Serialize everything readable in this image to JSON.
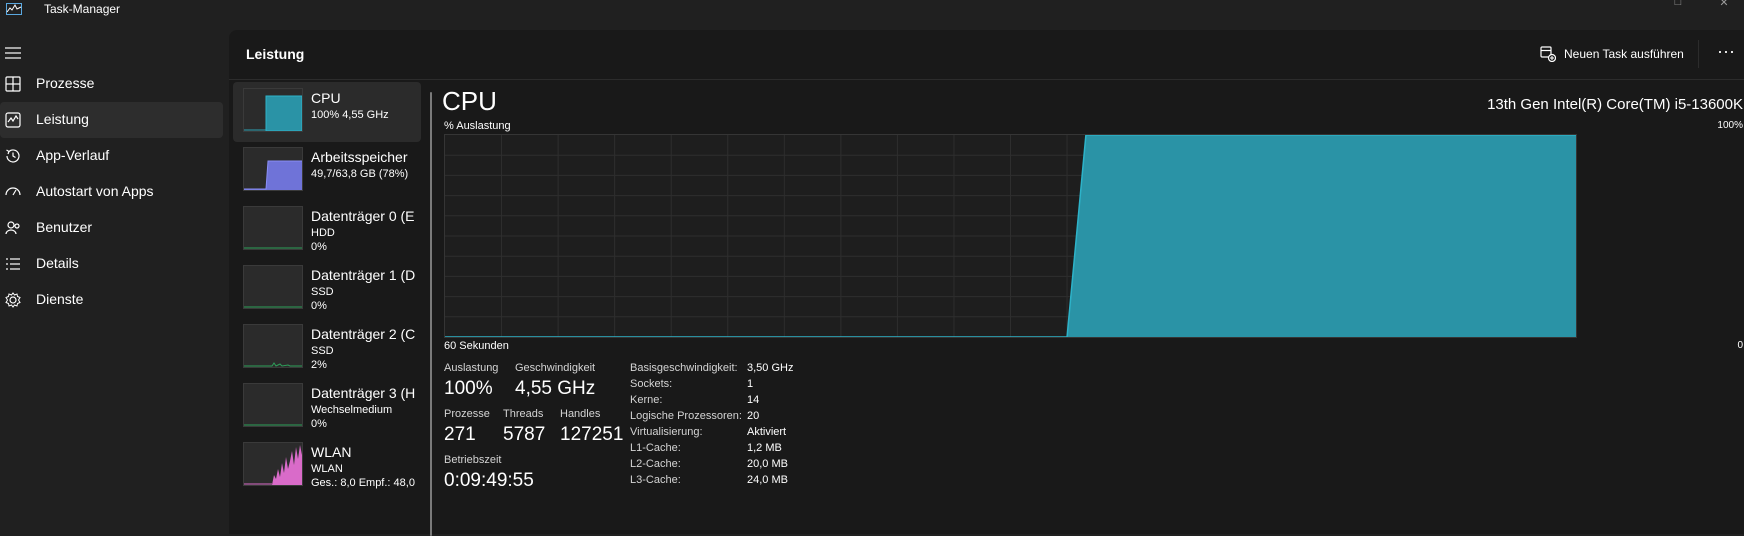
{
  "window": {
    "title": "Task-Manager"
  },
  "nav": {
    "items": [
      {
        "label": "Prozesse",
        "icon": "processes-icon"
      },
      {
        "label": "Leistung",
        "icon": "performance-icon",
        "selected": true
      },
      {
        "label": "App-Verlauf",
        "icon": "history-icon"
      },
      {
        "label": "Autostart von Apps",
        "icon": "startup-icon"
      },
      {
        "label": "Benutzer",
        "icon": "users-icon"
      },
      {
        "label": "Details",
        "icon": "details-icon"
      },
      {
        "label": "Dienste",
        "icon": "services-icon"
      }
    ]
  },
  "header": {
    "title": "Leistung",
    "new_task_label": "Neuen Task ausführen",
    "more_label": "···"
  },
  "resources": [
    {
      "name": "CPU",
      "line1": "100%  4,55 GHz",
      "line2": "",
      "color": "#2da0b3",
      "usage": 1.0
    },
    {
      "name": "Arbeitsspeicher",
      "line1": "49,7/63,8 GB (78%)",
      "line2": "",
      "color": "#7b7ff0",
      "usage": 0.78
    },
    {
      "name": "Datenträger 0 (E",
      "line1": "HDD",
      "line2": "0%",
      "color": "#2da05a",
      "usage": 0
    },
    {
      "name": "Datenträger 1 (D",
      "line1": "SSD",
      "line2": "0%",
      "color": "#2da05a",
      "usage": 0
    },
    {
      "name": "Datenträger 2 (C",
      "line1": "SSD",
      "line2": "2%",
      "color": "#2da05a",
      "usage": 0.02
    },
    {
      "name": "Datenträger 3 (H",
      "line1": "Wechselmedium",
      "line2": "0%",
      "color": "#2da05a",
      "usage": 0
    },
    {
      "name": "WLAN",
      "line1": "WLAN",
      "line2": "Ges.: 8,0  Empf.: 48,0",
      "color": "#d96bc9",
      "usage": 0.6
    }
  ],
  "cpu": {
    "title": "CPU",
    "model": "13th Gen Intel(R) Core(TM) i5-13600K",
    "axis_top_left": "% Auslastung",
    "axis_top_right": "100%",
    "axis_bottom_left": "60 Sekunden",
    "axis_bottom_right": "0",
    "graph_color": "#2a93a6",
    "graph_line_color": "#2db3c9",
    "stats": {
      "utilization": {
        "label": "Auslastung",
        "value": "100%"
      },
      "speed": {
        "label": "Geschwindigkeit",
        "value": "4,55 GHz"
      },
      "processes": {
        "label": "Prozesse",
        "value": "271"
      },
      "threads": {
        "label": "Threads",
        "value": "5787"
      },
      "handles": {
        "label": "Handles",
        "value": "127251"
      },
      "uptime": {
        "label": "Betriebszeit",
        "value": "0:09:49:55"
      }
    },
    "specs": [
      {
        "label": "Basisgeschwindigkeit:",
        "value": "3,50 GHz"
      },
      {
        "label": "Sockets:",
        "value": "1"
      },
      {
        "label": "Kerne:",
        "value": "14"
      },
      {
        "label": "Logische Prozessoren:",
        "value": "20"
      },
      {
        "label": "Virtualisierung:",
        "value": "Aktiviert"
      },
      {
        "label": "L1-Cache:",
        "value": "1,2 MB"
      },
      {
        "label": "L2-Cache:",
        "value": "20,0 MB"
      },
      {
        "label": "L3-Cache:",
        "value": "24,0 MB"
      }
    ]
  },
  "chart_data": {
    "type": "area",
    "title": "CPU",
    "ylabel": "% Auslastung",
    "xlabel": "60 Sekunden",
    "ylim": [
      0,
      100
    ],
    "xlim": [
      60,
      0
    ],
    "grid": true,
    "series": [
      {
        "x": [
          60,
          27,
          26,
          0
        ],
        "values": [
          0,
          0,
          100,
          100
        ]
      }
    ]
  }
}
